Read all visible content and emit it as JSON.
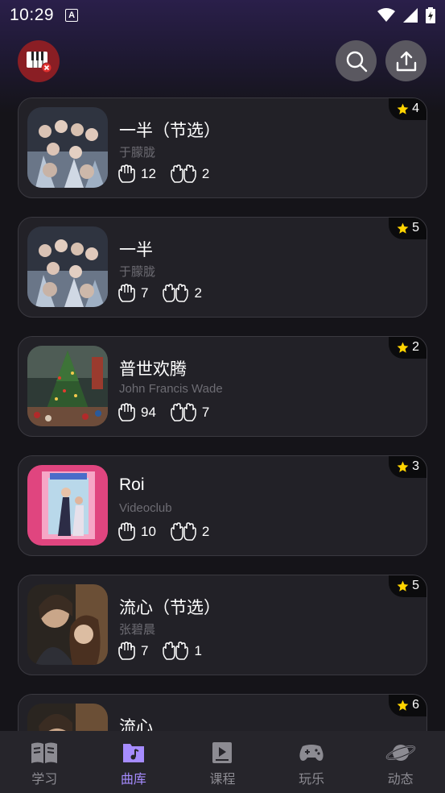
{
  "status": {
    "time": "10:29",
    "a_icon": "A"
  },
  "header": {
    "left_icon": "piano-off-icon",
    "search_icon": "search-icon",
    "upload_icon": "upload-icon"
  },
  "songs": [
    {
      "title": "一半（节选）",
      "artist": "于朦胧",
      "one_hand": "12",
      "two_hand": "2",
      "stars": "4",
      "cover": "group-poster"
    },
    {
      "title": "一半",
      "artist": "于朦胧",
      "one_hand": "7",
      "two_hand": "2",
      "stars": "5",
      "cover": "group-poster"
    },
    {
      "title": "普世欢腾",
      "artist": "John Francis Wade",
      "one_hand": "94",
      "two_hand": "7",
      "stars": "2",
      "cover": "christmas-tree"
    },
    {
      "title": "Roi",
      "artist": "Videoclub",
      "one_hand": "10",
      "two_hand": "2",
      "stars": "3",
      "cover": "pink-poster"
    },
    {
      "title": "流心（节选）",
      "artist": "张碧晨",
      "one_hand": "7",
      "two_hand": "1",
      "stars": "5",
      "cover": "couple-poster"
    },
    {
      "title": "流心",
      "artist": "",
      "one_hand": "",
      "two_hand": "",
      "stars": "6",
      "cover": "couple-poster"
    }
  ],
  "tabs": [
    {
      "label": "学习",
      "icon": "book-icon",
      "active": false
    },
    {
      "label": "曲库",
      "icon": "music-folder-icon",
      "active": true
    },
    {
      "label": "课程",
      "icon": "video-lesson-icon",
      "active": false
    },
    {
      "label": "玩乐",
      "icon": "gamepad-icon",
      "active": false
    },
    {
      "label": "动态",
      "icon": "planet-icon",
      "active": false
    }
  ],
  "colors": {
    "accent": "#a68cff",
    "star": "#ffd400",
    "piano_bg": "#8a1e24"
  }
}
